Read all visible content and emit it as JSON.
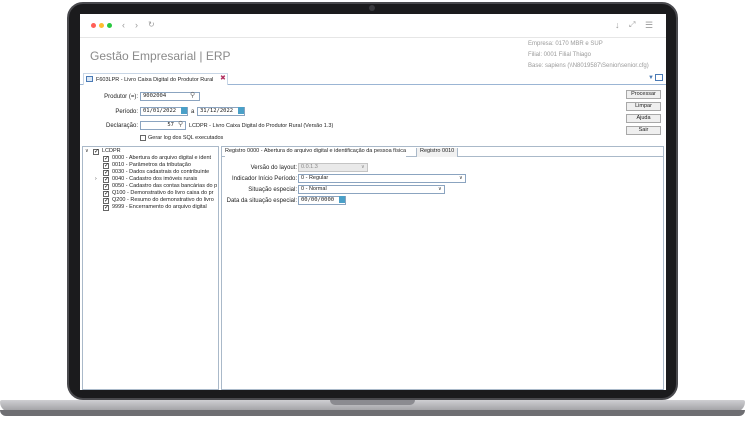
{
  "browser": {
    "colors": {
      "close": "#ff5f57",
      "minimize": "#febc2e",
      "maximize": "#28c840"
    }
  },
  "app": {
    "title": "Gestão Empresarial | ERP",
    "company": "Empresa: 0170 MBR e SUP",
    "branch": "Filial: 0001 Filial Thiago",
    "base": "Base: sapiens (\\\\N8019587\\Senior\\senior.cfg)"
  },
  "tab": {
    "label": "F603LPR - Livro Caixa Digital do Produtor Rural"
  },
  "form": {
    "produtor_label": "Produtor (=):",
    "produtor_value": "9002004",
    "periodo_label": "Período:",
    "periodo_start": "01/01/2022",
    "periodo_sep": "a",
    "periodo_end": "31/12/2022",
    "declaracao_label": "Declaração:",
    "declaracao_value": "57",
    "declaracao_desc": "LCDPR - Livro Caixa Digital do Produtor Rural (Versão 1.3)",
    "log_label": "Gerar log dos SQL executados"
  },
  "buttons": {
    "processar": "Processar",
    "limpar": "Limpar",
    "ajuda": "Ajuda",
    "sair": "Sair"
  },
  "tree": {
    "root": "LCDPR",
    "items": [
      "0000 - Abertura do arquivo digital e ident",
      "0010 - Parâmetros da tributação",
      "0030 - Dados cadastrais do contribuinte",
      "0040 - Cadastro dos imóveis rurais",
      "0050 - Cadastro das contas bancárias do p",
      "Q100 - Demonstrativo do livro caixa do pr",
      "Q200 - Resumo do demonstrativo do livro",
      "9999 - Encerramento do arquivo digital"
    ]
  },
  "detail": {
    "tabs": [
      "Registro 0000 - Abertura do arquivo digital e identificação da pessoa física",
      "Registro 0010"
    ],
    "versao_label": "Versão do layout:",
    "versao_value": "0.0.1.3",
    "indicador_label": "Indicador Início Período:",
    "indicador_value": "0 - Regular",
    "situacao_label": "Situação especial:",
    "situacao_value": "0 - Normal",
    "data_label": "Data da situação especial:",
    "data_value": "00/00/0000"
  }
}
